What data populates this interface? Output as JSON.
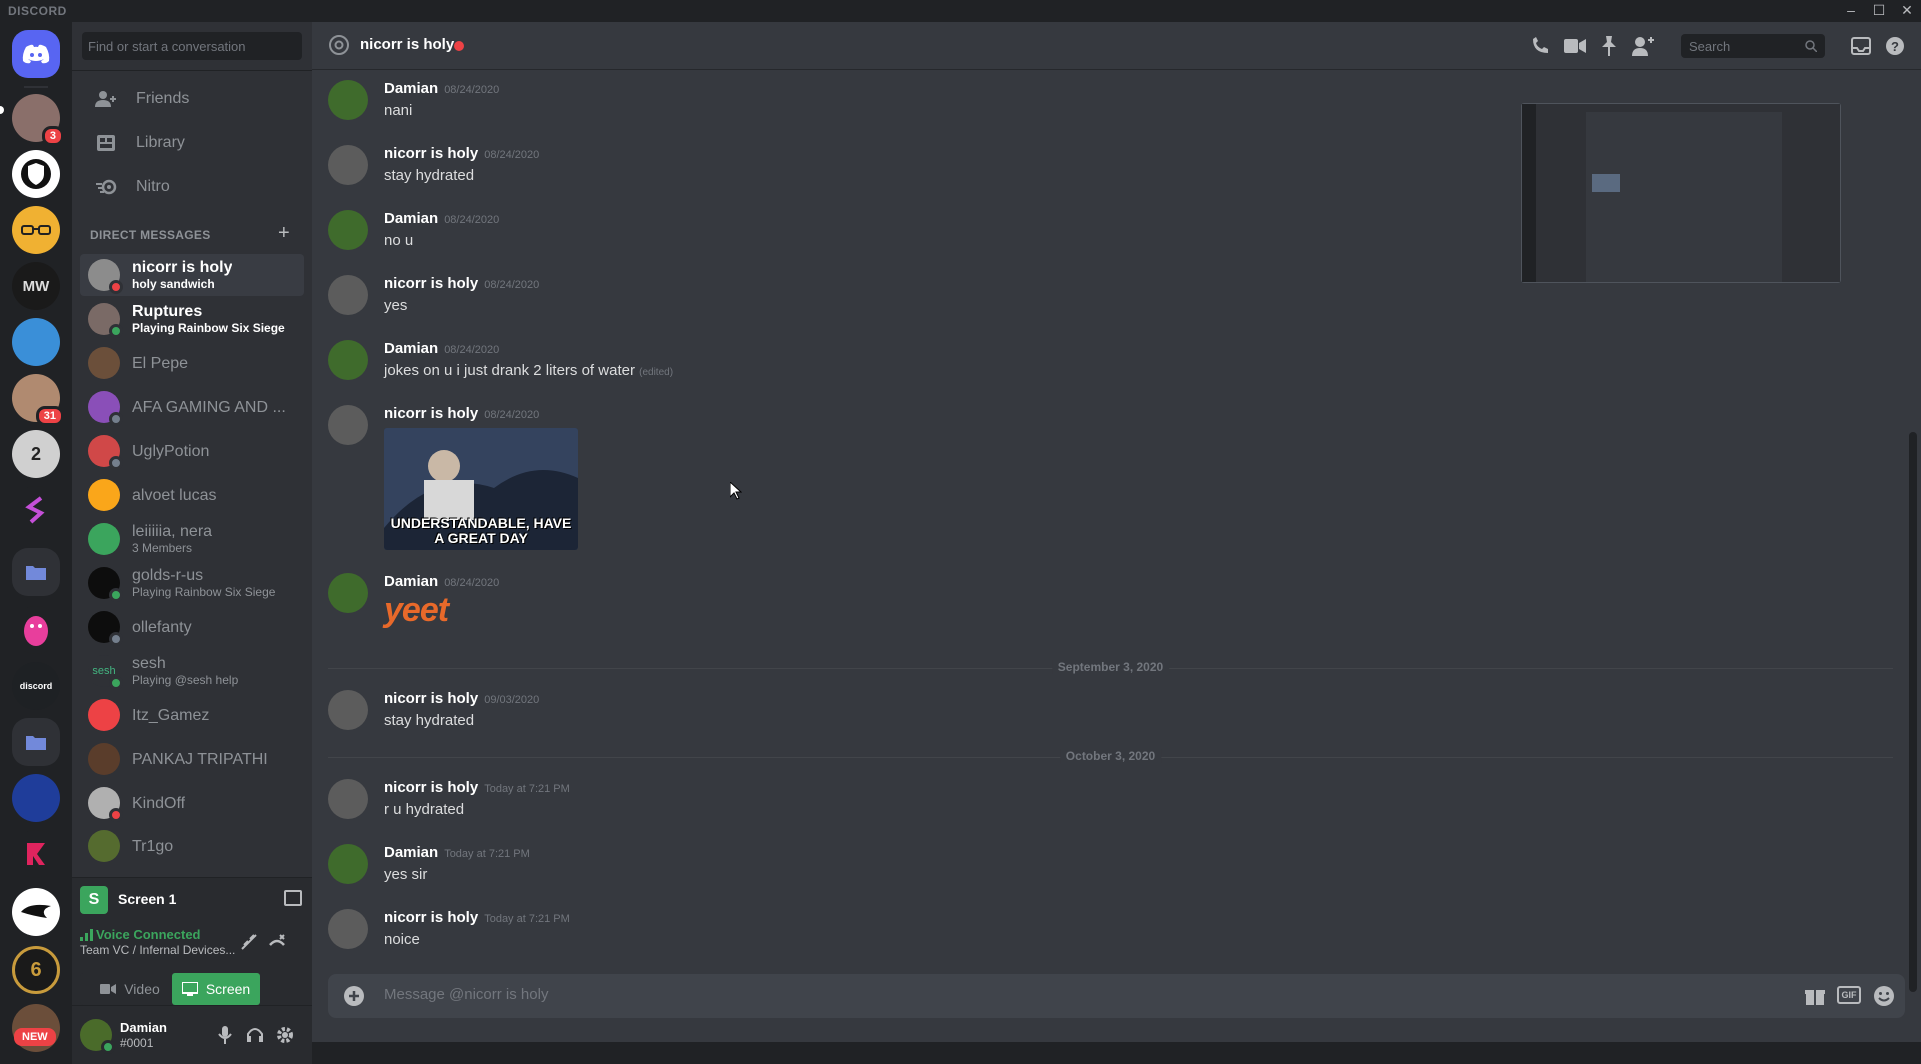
{
  "window": {
    "brand": "DISCORD",
    "minimize": "–",
    "maximize": "☐",
    "close": "✕"
  },
  "colors": {
    "blurple": "#5865f2",
    "green": "#3ba55d",
    "red": "#ed4245",
    "yellow": "#faa61a",
    "bg": "#36393f"
  },
  "guilds": [
    {
      "name": "home-discord-icon",
      "unread": ""
    },
    {
      "name": "server-avatar",
      "badge": "3"
    },
    {
      "name": "shield-server"
    },
    {
      "name": "glasses-server"
    },
    {
      "name": "mw-server"
    },
    {
      "name": "cartoon-server"
    },
    {
      "name": "cat-server",
      "badge": "31"
    },
    {
      "name": "two-server",
      "label": "2"
    },
    {
      "name": "s-server"
    },
    {
      "name": "folder-server"
    },
    {
      "name": "fall-guys-server"
    },
    {
      "name": "discord-bio-server",
      "label": "discord"
    },
    {
      "name": "folder-server-2"
    },
    {
      "name": "devices-server"
    },
    {
      "name": "fk-server"
    },
    {
      "name": "phoenix-server"
    },
    {
      "name": "siege-server",
      "label": "6"
    },
    {
      "name": "new-server"
    }
  ],
  "new_badge": "NEW",
  "sidebar": {
    "search_placeholder": "Find or start a conversation",
    "nav": [
      {
        "label": "Friends"
      },
      {
        "label": "Library"
      },
      {
        "label": "Nitro"
      }
    ],
    "dm_header": "DIRECT MESSAGES",
    "dm_add": "+",
    "dms": [
      {
        "name": "nicorr is holy",
        "sub": "holy sandwich",
        "status": "dnd",
        "active": true
      },
      {
        "name": "Ruptures",
        "sub": "Playing Rainbow Six Siege",
        "status": "online"
      },
      {
        "name": "El Pepe",
        "sub": "",
        "status": "offline"
      },
      {
        "name": "AFA GAMING AND ...",
        "sub": "",
        "status": "offline"
      },
      {
        "name": "UglyPotion",
        "sub": "",
        "status": "offline"
      },
      {
        "name": "alvoet lucas",
        "sub": "",
        "status": "offline"
      },
      {
        "name": "leiiiiia, nera",
        "sub": "3 Members",
        "status": "group"
      },
      {
        "name": "golds-r-us",
        "sub": "Playing Rainbow Six Siege",
        "status": "online"
      },
      {
        "name": "ollefanty",
        "sub": "",
        "status": "offline"
      },
      {
        "name": "sesh",
        "sub": "Playing @sesh help",
        "status": "online"
      },
      {
        "name": "Itz_Gamez",
        "sub": "",
        "status": "offline"
      },
      {
        "name": "PANKAJ TRIPATHI",
        "sub": "",
        "status": "offline"
      },
      {
        "name": "KindOff",
        "sub": "",
        "status": "dnd"
      },
      {
        "name": "Tr1go",
        "sub": "",
        "status": "offline"
      }
    ]
  },
  "screen_share": {
    "title": "Screen 1"
  },
  "voice": {
    "status": "Voice Connected",
    "channel": "Team VC / Infernal Devices...",
    "video_label": "Video",
    "screen_label": "Screen"
  },
  "user": {
    "name": "Damian",
    "tag": "#0001"
  },
  "chat": {
    "recipient": "nicorr is holy",
    "search_placeholder": "Search",
    "composer_placeholder": "Message @nicorr is holy",
    "messages": [
      {
        "author": "Damian",
        "time": "08/24/2020",
        "text": "nani"
      },
      {
        "author": "nicorr is holy",
        "time": "08/24/2020",
        "text": "stay hydrated"
      },
      {
        "author": "Damian",
        "time": "08/24/2020",
        "text": "no u"
      },
      {
        "author": "nicorr is holy",
        "time": "08/24/2020",
        "text": "yes"
      },
      {
        "author": "Damian",
        "time": "08/24/2020",
        "text": "jokes on u i just drank 2 liters of water",
        "edited": "(edited)"
      },
      {
        "author": "nicorr is holy",
        "time": "08/24/2020",
        "image_caption": "UNDERSTANDABLE, HAVE A GREAT DAY"
      },
      {
        "author": "Damian",
        "time": "08/24/2020",
        "sticker": "yeet"
      },
      {
        "author": "nicorr is holy",
        "time": "09/03/2020",
        "text": "stay hydrated"
      },
      {
        "author": "nicorr is holy",
        "time": "Today at 7:21 PM",
        "text": "r u hydrated"
      },
      {
        "author": "Damian",
        "time": "Today at 7:21 PM",
        "text": "yes sir"
      },
      {
        "author": "nicorr is holy",
        "time": "Today at 7:21 PM",
        "text": "noice"
      }
    ],
    "dividers": [
      "September 3, 2020",
      "October 3, 2020"
    ]
  }
}
